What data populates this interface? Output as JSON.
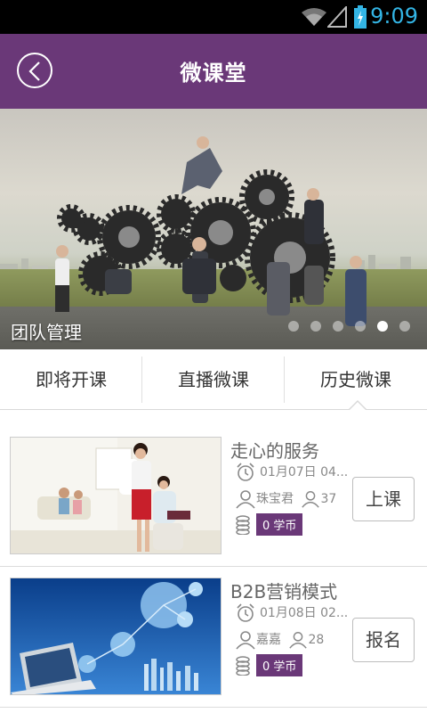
{
  "status_bar": {
    "time": "9:09"
  },
  "header": {
    "title": "微课堂",
    "back_icon": "chevron-left-icon"
  },
  "banner": {
    "caption": "团队管理",
    "slide_count": 6,
    "active_slide": 5
  },
  "tabs": [
    {
      "label": "即将开课"
    },
    {
      "label": "直播微课"
    },
    {
      "label": "历史微课",
      "selected": true
    }
  ],
  "courses": [
    {
      "title": "走心的服务",
      "date": "01月07日 04...",
      "teacher": "珠宝君",
      "attendees": "37",
      "coins": "0 学币",
      "action": "上课"
    },
    {
      "title": "B2B营销模式",
      "date": "01月08日 02...",
      "teacher": "嘉嘉",
      "attendees": "28",
      "coins": "0 学币",
      "action": "报名"
    }
  ],
  "colors": {
    "brand": "#6a3878",
    "status_accent": "#33b5e5"
  }
}
